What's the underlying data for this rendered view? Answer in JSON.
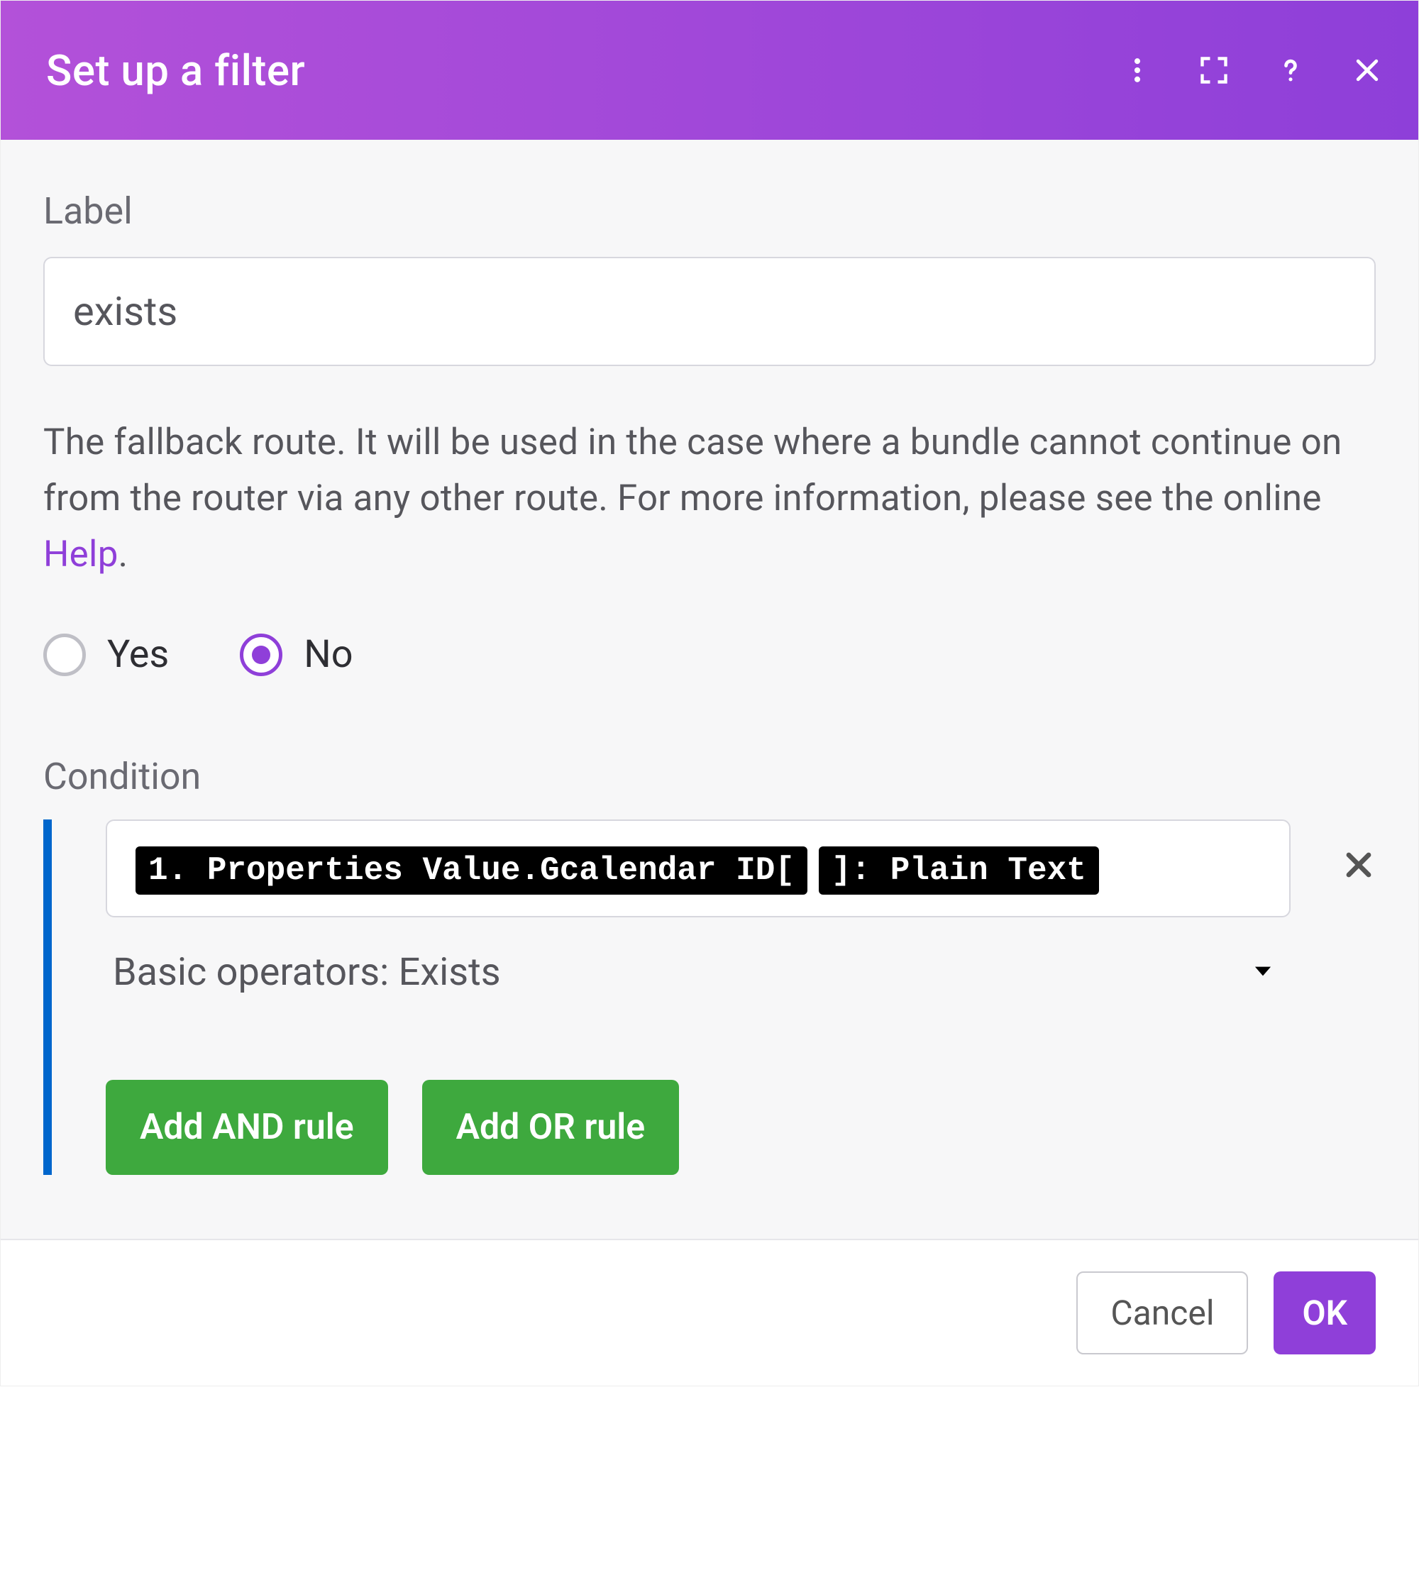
{
  "header": {
    "title": "Set up a filter"
  },
  "label_field": {
    "label": "Label",
    "value": "exists"
  },
  "description": {
    "text_before_link": "The fallback route. It will be used in the case where a bundle cannot continue on from the router via any other route. For more information, please see the online ",
    "link_text": "Help",
    "text_after_link": "."
  },
  "radio": {
    "yes": "Yes",
    "no": "No",
    "selected": "no"
  },
  "condition": {
    "label": "Condition",
    "pills": {
      "line1": "1. Properties Value.Gcalendar ID[",
      "line2": "]: Plain Text"
    },
    "operator": "Basic operators: Exists",
    "add_and": "Add AND rule",
    "add_or": "Add OR rule"
  },
  "footer": {
    "cancel": "Cancel",
    "ok": "OK"
  }
}
